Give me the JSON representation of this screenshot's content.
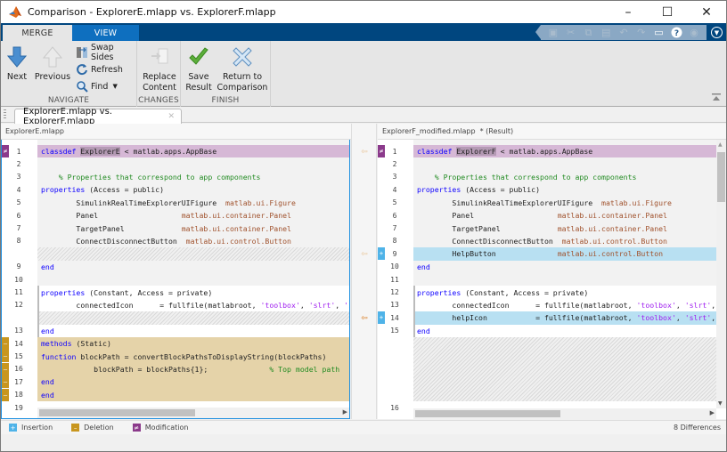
{
  "window": {
    "title": "Comparison - ExplorerE.mlapp vs. ExplorerF.mlapp",
    "minimize_glyph": "–",
    "maximize_glyph": "☐",
    "close_glyph": "✕"
  },
  "ribbon": {
    "tabs": [
      {
        "label": "MERGE",
        "active": true
      },
      {
        "label": "VIEW",
        "active": false
      }
    ],
    "quick_access": [
      {
        "icon": "save-icon",
        "enabled": false
      },
      {
        "icon": "cut-icon",
        "enabled": false
      },
      {
        "icon": "copy-icon",
        "enabled": false
      },
      {
        "icon": "paste-icon",
        "enabled": false
      },
      {
        "icon": "undo-icon",
        "enabled": false
      },
      {
        "icon": "redo-icon",
        "enabled": false
      },
      {
        "icon": "window-layout-icon",
        "enabled": true
      },
      {
        "icon": "help-icon",
        "enabled": true
      },
      {
        "icon": "options-icon",
        "enabled": false
      }
    ],
    "groups": {
      "navigate": {
        "label": "NAVIGATE",
        "next": "Next",
        "previous": "Previous",
        "swap_sides": "Swap Sides",
        "refresh": "Refresh",
        "find": "Find"
      },
      "changes": {
        "label": "CHANGES",
        "replace_content_1": "Replace",
        "replace_content_2": "Content"
      },
      "finish": {
        "label": "FINISH",
        "save_result_1": "Save",
        "save_result_2": "Result",
        "return_1": "Return to",
        "return_2": "Comparison"
      }
    }
  },
  "document_tab": {
    "label": "ExplorerE.mlapp vs. ExplorerF.mlapp"
  },
  "left": {
    "header": "ExplorerE.mlapp"
  },
  "right": {
    "header": "ExplorerF_modified.mlapp  * (Result)"
  },
  "legend": {
    "insertion": "Insertion",
    "deletion": "Deletion",
    "modification": "Modification",
    "colors": {
      "insertion": "#4fb3e8",
      "deletion": "#c8961e",
      "modification": "#8b3a8b"
    }
  },
  "status": {
    "differences": "8 Differences"
  }
}
